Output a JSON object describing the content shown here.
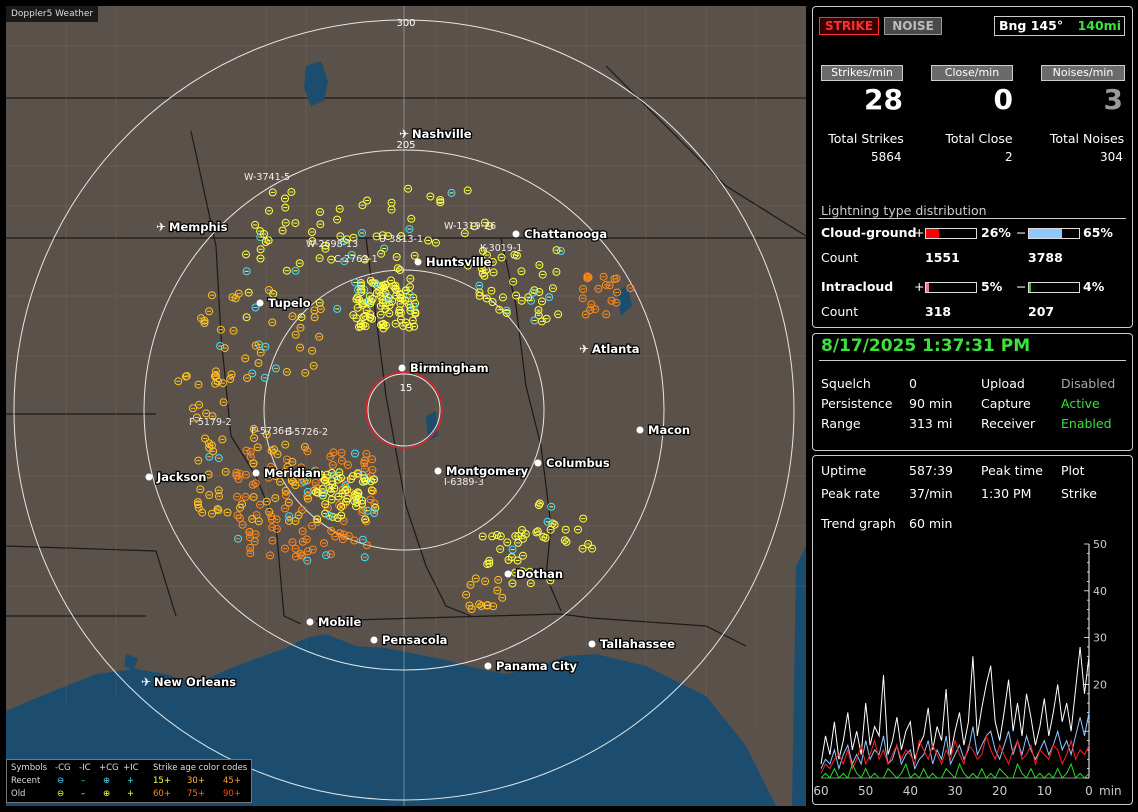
{
  "app": {
    "title": "Doppler5 Weather"
  },
  "map": {
    "range_labels": [
      "300",
      "205",
      "15"
    ],
    "cities": [
      {
        "name": "Nashville",
        "type": "airport"
      },
      {
        "name": "Chattanooga",
        "type": "city"
      },
      {
        "name": "Memphis",
        "type": "airport"
      },
      {
        "name": "Huntsville",
        "type": "city"
      },
      {
        "name": "Tupelo",
        "type": "city"
      },
      {
        "name": "Atlanta",
        "type": "airport"
      },
      {
        "name": "Birmingham",
        "type": "city"
      },
      {
        "name": "Macon",
        "type": "city"
      },
      {
        "name": "Jackson",
        "type": "city"
      },
      {
        "name": "Meridian",
        "type": "city"
      },
      {
        "name": "Montgomery",
        "type": "city"
      },
      {
        "name": "Columbus",
        "type": "city"
      },
      {
        "name": "Dothan",
        "type": "city"
      },
      {
        "name": "Mobile",
        "type": "city"
      },
      {
        "name": "Pensacola",
        "type": "city"
      },
      {
        "name": "Tallahassee",
        "type": "city"
      },
      {
        "name": "Panama City",
        "type": "city"
      },
      {
        "name": "New Orleans",
        "type": "airport"
      }
    ],
    "storm_labels": [
      "W-3741-5",
      "W-1319-26",
      "W-2698-13",
      "U-3813-1",
      "K-3019-1",
      "C-2763-1",
      "F-5179-2",
      "F-5736-1",
      "E-5726-2",
      "I-6389-3"
    ],
    "colors": {
      "land": "#5b514b",
      "water": "#1c4d6e",
      "range_ring": "#ffffff",
      "close_ring": "#e0202a",
      "recent": "#ffff40",
      "mid": "#ffc020",
      "old": "#ff8a1a",
      "ic_recent": "#40e0ff"
    }
  },
  "legend": {
    "symbols_label": "Symbols",
    "cols": [
      "-CG",
      "-IC",
      "+CG",
      "+IC"
    ],
    "recent_label": "Recent",
    "old_label": "Old",
    "age_label": "Strike age color codes",
    "ages_recent": [
      "15+",
      "30+",
      "45+"
    ],
    "ages_old": [
      "60+",
      "75+",
      "90+"
    ]
  },
  "panel1": {
    "strike_btn": "STRIKE",
    "noise_btn": "NOISE",
    "bearing": "Bng 145°",
    "distance": "140mi",
    "strikes_min_label": "Strikes/min",
    "close_min_label": "Close/min",
    "noises_min_label": "Noises/min",
    "strikes_min": "28",
    "close_min": "0",
    "noises_min": "3",
    "total_strikes_label": "Total Strikes",
    "total_close_label": "Total Close",
    "total_noises_label": "Total Noises",
    "total_strikes": "5864",
    "total_close": "2",
    "total_noises": "304",
    "dist_title": "Lightning type distribution",
    "cg_label": "Cloud-ground",
    "ic_label": "Intracloud",
    "count_label": "Count",
    "plus": "+",
    "minus": "−",
    "cg_pos_pct": "26%",
    "cg_neg_pct": "65%",
    "cg_pos_count": "1551",
    "cg_neg_count": "3788",
    "ic_pos_pct": "5%",
    "ic_neg_pct": "4%",
    "ic_pos_count": "318",
    "ic_neg_count": "207",
    "bars": {
      "cg_pos": 26,
      "cg_neg": 65,
      "ic_pos": 5,
      "ic_neg": 4
    },
    "bar_colors": {
      "cg_pos": "#ff0000",
      "cg_neg": "#8ec8ff",
      "ic_pos": "#ff69b4",
      "ic_neg": "#22cc22"
    }
  },
  "panel2": {
    "datetime": "8/17/2025 1:37:31 PM",
    "squelch_label": "Squelch",
    "squelch": "0",
    "persistence_label": "Persistence",
    "persistence": "90 min",
    "range_label": "Range",
    "range": "313 mi",
    "upload_label": "Upload",
    "upload": "Disabled",
    "capture_label": "Capture",
    "capture": "Active",
    "receiver_label": "Receiver",
    "receiver": "Enabled"
  },
  "panel3": {
    "uptime_label": "Uptime",
    "uptime": "587:39",
    "peak_time_label": "Peak time",
    "peak_time": "1:30 PM",
    "plot_label": "Plot",
    "plot": "Strike",
    "peak_rate_label": "Peak rate",
    "peak_rate": "37/min",
    "trend_label": "Trend graph",
    "trend": "60 min"
  },
  "chart_data": {
    "type": "line",
    "xlabel": "min",
    "x_ticks": [
      60,
      50,
      40,
      30,
      20,
      10,
      0
    ],
    "y_ticks": [
      20,
      30,
      40,
      50
    ],
    "ylim": [
      0,
      50
    ],
    "xlim": [
      60,
      0
    ],
    "series_colors": [
      "#ffffff",
      "#8ec8ff",
      "#ff2020",
      "#22dd22"
    ],
    "series": [
      {
        "values": [
          3,
          9,
          5,
          12,
          4,
          8,
          14,
          6,
          10,
          5,
          16,
          7,
          11,
          9,
          22,
          5,
          8,
          13,
          6,
          10,
          12,
          4,
          7,
          9,
          15,
          6,
          11,
          8,
          19,
          5,
          10,
          14,
          7,
          12,
          26,
          9,
          15,
          20,
          24,
          12,
          8,
          14,
          21,
          10,
          16,
          9,
          18,
          13,
          7,
          11,
          17,
          9,
          14,
          20,
          12,
          16,
          10,
          19,
          28,
          18,
          26
        ]
      },
      {
        "values": [
          2,
          4,
          3,
          6,
          2,
          5,
          7,
          3,
          5,
          3,
          8,
          4,
          6,
          5,
          9,
          3,
          4,
          7,
          3,
          5,
          6,
          2,
          4,
          5,
          8,
          3,
          6,
          4,
          9,
          3,
          5,
          7,
          4,
          6,
          11,
          5,
          7,
          9,
          10,
          6,
          4,
          7,
          10,
          5,
          8,
          5,
          9,
          6,
          4,
          6,
          8,
          5,
          7,
          10,
          6,
          8,
          5,
          9,
          13,
          9,
          14
        ]
      },
      {
        "values": [
          1,
          3,
          2,
          4,
          5,
          3,
          6,
          2,
          4,
          7,
          3,
          5,
          8,
          4,
          6,
          3,
          5,
          7,
          4,
          6,
          5,
          3,
          8,
          6,
          4,
          7,
          5,
          3,
          6,
          4,
          8,
          5,
          3,
          7,
          6,
          4,
          5,
          9,
          6,
          4,
          7,
          5,
          3,
          6,
          8,
          4,
          5,
          7,
          3,
          6,
          5,
          4,
          7,
          6,
          3,
          5,
          8,
          4,
          6,
          5,
          7
        ]
      },
      {
        "values": [
          0,
          1,
          0,
          2,
          0,
          1,
          0,
          3,
          1,
          0,
          2,
          0,
          1,
          0,
          0,
          2,
          1,
          0,
          1,
          3,
          0,
          1,
          0,
          2,
          0,
          1,
          0,
          0,
          2,
          1,
          0,
          3,
          1,
          0,
          1,
          0,
          2,
          0,
          1,
          0,
          2,
          1,
          0,
          0,
          3,
          1,
          0,
          2,
          0,
          1,
          0,
          1,
          0,
          2,
          0,
          1,
          3,
          0,
          1,
          0,
          1
        ]
      }
    ]
  }
}
